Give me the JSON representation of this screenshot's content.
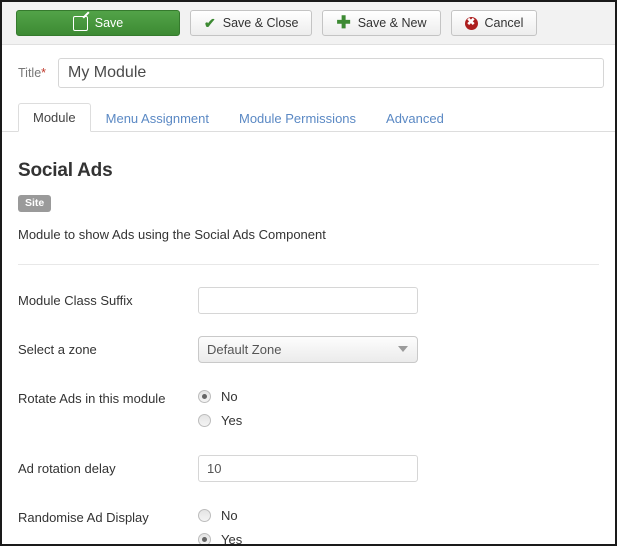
{
  "toolbar": {
    "buttons": [
      {
        "label": "Save",
        "icon": "pencil-icon",
        "style": "primary"
      },
      {
        "label": "Save & Close",
        "icon": "check-icon",
        "style": "default"
      },
      {
        "label": "Save & New",
        "icon": "plus-icon",
        "style": "default"
      },
      {
        "label": "Cancel",
        "icon": "cancel-icon",
        "style": "default"
      }
    ]
  },
  "title_field": {
    "label": "Title",
    "required_marker": "*",
    "value": "My Module",
    "placeholder": ""
  },
  "tabs": [
    {
      "label": "Module",
      "active": true
    },
    {
      "label": "Menu Assignment",
      "active": false
    },
    {
      "label": "Module Permissions",
      "active": false
    },
    {
      "label": "Advanced",
      "active": false
    }
  ],
  "module": {
    "name": "Social Ads",
    "badge": "Site",
    "description": "Module to show Ads using the Social Ads Component"
  },
  "fields": {
    "module_class_suffix": {
      "label": "Module Class Suffix",
      "value": "",
      "placeholder": ""
    },
    "select_zone": {
      "label": "Select a zone",
      "selected": "Default Zone",
      "caret": "chevron-down-icon"
    },
    "rotate_ads": {
      "label": "Rotate Ads in this module",
      "options": [
        {
          "label": "No",
          "checked": true
        },
        {
          "label": "Yes",
          "checked": false
        }
      ]
    },
    "ad_rotation_delay": {
      "label": "Ad rotation delay",
      "value": "10",
      "placeholder": ""
    },
    "randomise_ad_display": {
      "label": "Randomise Ad Display",
      "options": [
        {
          "label": "No",
          "checked": false
        },
        {
          "label": "Yes",
          "checked": true
        }
      ]
    }
  },
  "colors": {
    "primary_green": "#3d8a33",
    "link_blue": "#5b89c4",
    "badge_gray": "#9a9a9a",
    "cancel_red": "#ad1f1f",
    "required_red": "#c0392b"
  }
}
